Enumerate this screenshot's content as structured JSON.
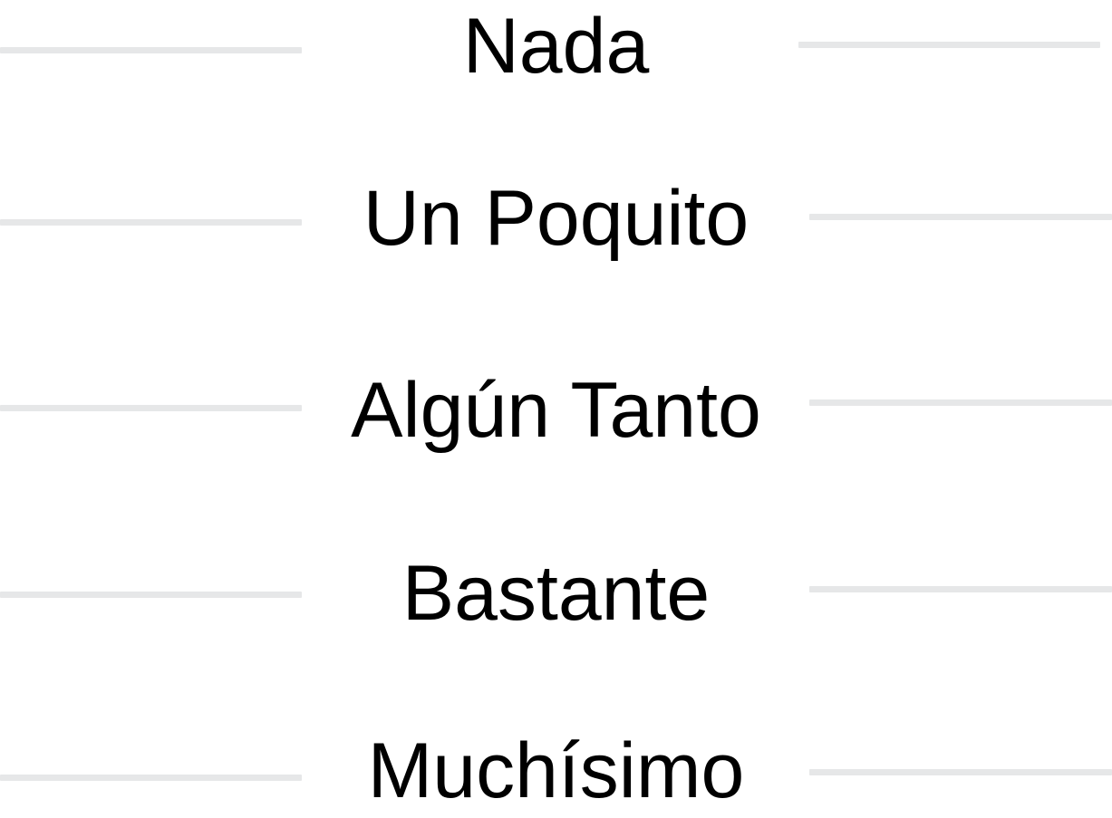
{
  "scale": {
    "options": [
      {
        "label": "Nada"
      },
      {
        "label": "Un Poquito"
      },
      {
        "label": "Algún Tanto"
      },
      {
        "label": "Bastante"
      },
      {
        "label": "Muchísimo"
      }
    ]
  },
  "colors": {
    "text": "#000000",
    "rule": "#e6e7e8",
    "background": "#ffffff"
  }
}
